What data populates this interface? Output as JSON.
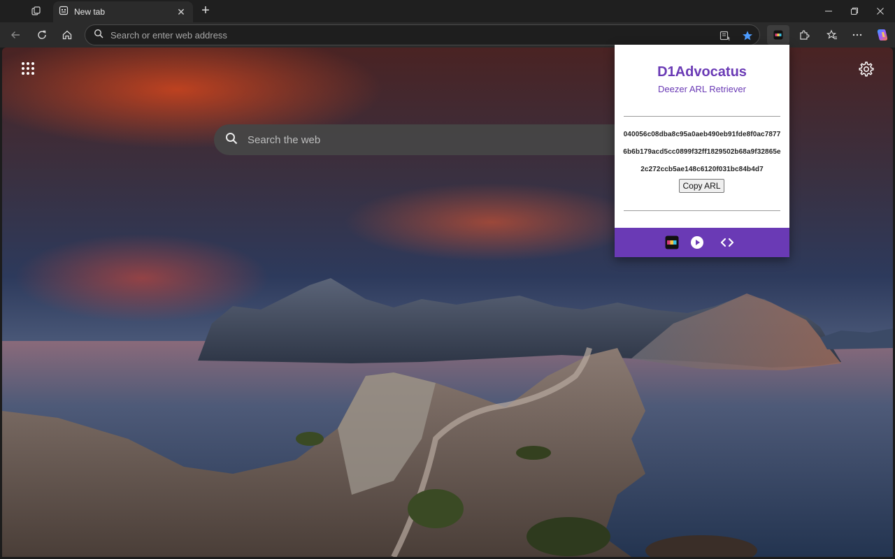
{
  "browser": {
    "tab": {
      "title": "New tab",
      "close_glyph": "✕"
    },
    "new_tab_glyph": "+",
    "window_controls": {
      "minimize": "—",
      "maximize": "❐",
      "close": "✕"
    },
    "address_bar": {
      "placeholder": "Search or enter web address",
      "value": ""
    },
    "icons": [
      "workspaces-icon",
      "back-icon",
      "refresh-icon",
      "home-icon",
      "search-icon",
      "reading-view-icon",
      "favorite-star-icon",
      "d1a-extension-icon",
      "extensions-icon",
      "favorites-icon",
      "more-icon",
      "copilot-icon"
    ]
  },
  "newtab": {
    "search": {
      "placeholder": "Search the web"
    },
    "icons": [
      "apps-grid-icon",
      "settings-gear-icon"
    ]
  },
  "popup": {
    "title": "D1Advocatus",
    "subtitle": "Deezer ARL Retriever",
    "arl_lines": [
      "040056c08dba8c95a0aeb490eb91fde8f0ac7877",
      "6b6b179acd5cc0899f32ff1829502b68a9f32865e",
      "2c272ccb5ae148c6120f031bc84b4d7"
    ],
    "copy_button": "Copy ARL",
    "accent_color": "#6a3ab5",
    "footer_icons": [
      "d1a-logo-icon",
      "play-icon",
      "code-icon"
    ]
  }
}
